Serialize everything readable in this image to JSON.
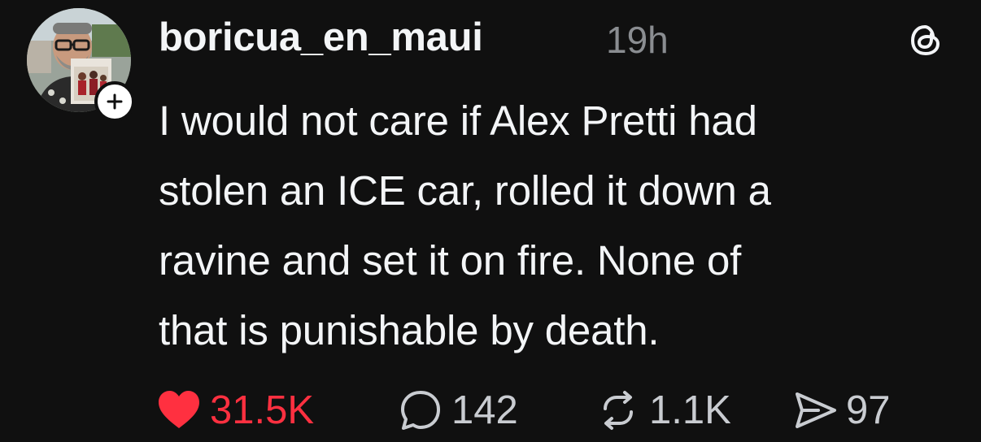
{
  "post": {
    "author": {
      "username": "boricua_en_maui",
      "avatar": "profile-photo",
      "follow_badge_icon": "plus-icon"
    },
    "timestamp": "19h",
    "platform_icon": "threads-logo-icon",
    "text_lines": [
      "I would not care if Alex Pretti had",
      "stolen an ICE car, rolled it down a",
      "ravine and set it on fire. None of",
      "that is punishable by death."
    ],
    "actions": {
      "like": {
        "icon": "heart-filled-icon",
        "count": "31.5K",
        "liked": true
      },
      "reply": {
        "icon": "speech-bubble-icon",
        "count": "142"
      },
      "repost": {
        "icon": "repost-arrows-icon",
        "count": "1.1K"
      },
      "share": {
        "icon": "paper-plane-icon",
        "count": "97"
      }
    }
  },
  "colors": {
    "background": "#101010",
    "text_primary": "#f3f5f7",
    "text_secondary": "#8a8d91",
    "like_active": "#ff3040"
  }
}
